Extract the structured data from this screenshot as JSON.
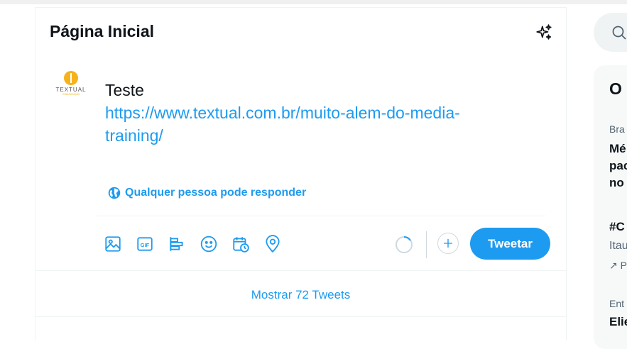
{
  "header": {
    "title": "Página Inicial",
    "sparkle_icon": "sparkle-icon"
  },
  "composer": {
    "avatar_label": "TEXTUAL",
    "avatar_sub": "COMUNICAÇÃO",
    "text_line": "Teste",
    "link_line1": "https://www.textual.com.br/muito-alem-do-media-",
    "link_line2": "training/",
    "reply_setting": "Qualquer pessoa pode responder",
    "tweet_button": "Tweetar",
    "tools": [
      "image-icon",
      "gif-icon",
      "poll-icon",
      "emoji-icon",
      "schedule-icon",
      "location-icon"
    ]
  },
  "feed": {
    "show_more": "Mostrar 72 Tweets"
  },
  "right": {
    "trends_title": "O",
    "items": [
      {
        "category": "Bra",
        "title_lines": [
          "Mé",
          "pac",
          "no "
        ]
      },
      {
        "title": "#C",
        "sub": "Itau",
        "promo_glyph": "↗ P"
      },
      {
        "category": "Ent",
        "title": "Elie"
      }
    ]
  },
  "colors": {
    "accent": "#1d9bf0",
    "text": "#0f1419",
    "muted": "#536471",
    "border": "#eff3f4"
  }
}
